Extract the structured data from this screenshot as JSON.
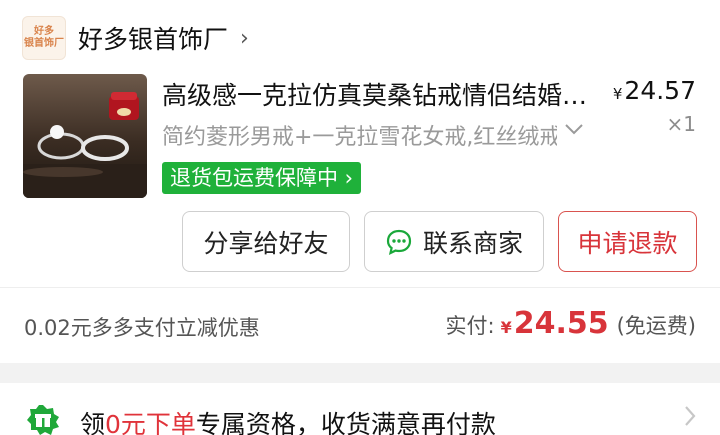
{
  "shop": {
    "logo_line1": "好多",
    "logo_line2": "银首饰厂",
    "name": "好多银首饰厂",
    "chevron": "›"
  },
  "product": {
    "title": "高级感一克拉仿真莫桑钻戒情侣结婚对戒",
    "price_currency": "¥",
    "price": "24.57",
    "spec": "简约菱形男戒+一克拉雪花女戒,红丝绒戒指盒",
    "quantity": "×1",
    "guarantee": "退货包运费保障中 ›"
  },
  "actions": {
    "share": "分享给好友",
    "contact": "联系商家",
    "refund": "申请退款"
  },
  "summary": {
    "discount": "0.02元多多支付立减优惠",
    "paid_label": "实付:",
    "paid_currency": "¥",
    "paid_amount": "24.55",
    "shipping": "(免运费)"
  },
  "promo": {
    "prefix": "领",
    "highlight": "0元下单",
    "suffix": "专属资格，收货满意再付款"
  },
  "icons": {
    "shop_chevron": "chevron-right-icon",
    "spec_chevron": "chevron-down-icon",
    "chat": "chat-bubble-icon",
    "promo": "gift-badge-icon",
    "promo_chevron": "chevron-right-icon"
  },
  "colors": {
    "accent_red": "#d8343a",
    "guarantee_green": "#1fb13a",
    "chat_green": "#1aa83a"
  }
}
